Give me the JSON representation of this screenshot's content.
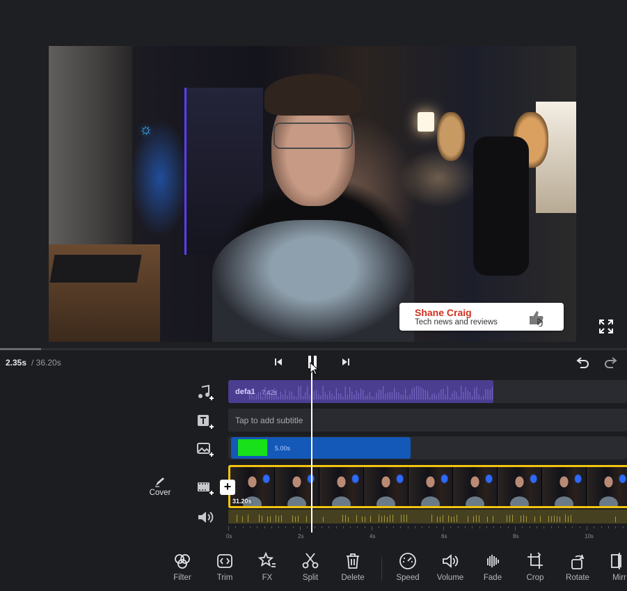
{
  "player": {
    "current_time": "2.35s",
    "total_time": "/ 36.20s",
    "progress": 0.065
  },
  "lower_third": {
    "name": "Shane Craig",
    "tagline": "Tech news and reviews"
  },
  "timeline": {
    "music": {
      "name": "defa1",
      "duration": "7.42s"
    },
    "subtitle": {
      "placeholder": "Tap to add subtitle"
    },
    "overlay": {
      "duration": "5.00s",
      "color": "#18e01a"
    },
    "video": {
      "duration": "31.20s",
      "cover_label": "Cover",
      "add_label": "+"
    },
    "ruler": [
      "0s",
      "2s",
      "4s",
      "6s",
      "8s",
      "10s"
    ],
    "colors": {
      "selection": "#f3c410",
      "music": "#4b3d8f",
      "overlay": "#1458b8"
    }
  },
  "toolbar": {
    "tools": [
      {
        "label": "Filter",
        "icon": "filter-icon"
      },
      {
        "label": "Trim",
        "icon": "trim-icon"
      },
      {
        "label": "FX",
        "icon": "fx-icon"
      },
      {
        "label": "Split",
        "icon": "split-icon"
      },
      {
        "label": "Delete",
        "icon": "delete-icon"
      },
      {
        "label": "Speed",
        "icon": "speed-icon"
      },
      {
        "label": "Volume",
        "icon": "volume-icon"
      },
      {
        "label": "Fade",
        "icon": "fade-icon"
      },
      {
        "label": "Crop",
        "icon": "crop-icon"
      },
      {
        "label": "Rotate",
        "icon": "rotate-icon"
      },
      {
        "label": "Mirr",
        "icon": "mirror-icon"
      }
    ]
  }
}
